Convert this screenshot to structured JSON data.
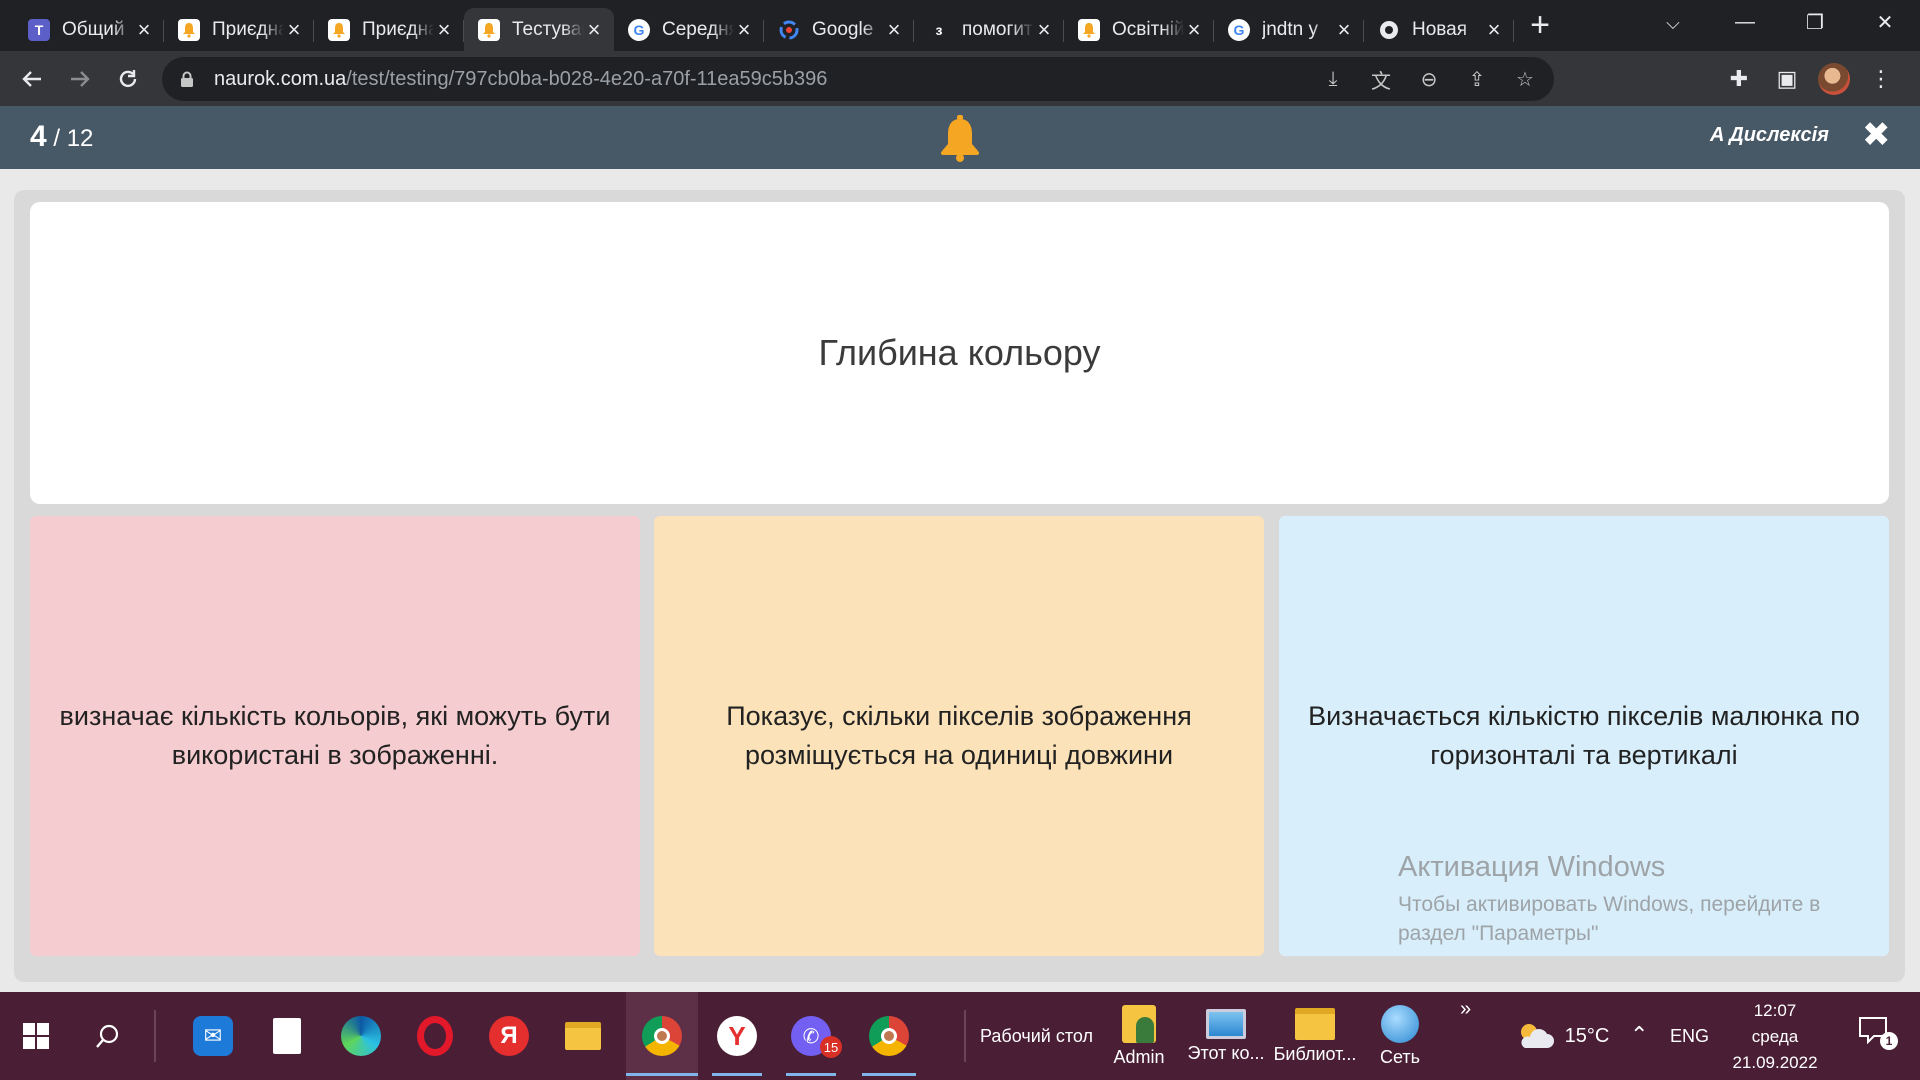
{
  "browser": {
    "tabs": [
      {
        "title": "Общий",
        "favicon": "teams-icon",
        "color": "#5b5fc7",
        "active": false
      },
      {
        "title": "Приєднатись",
        "favicon": "naurok-bell-icon",
        "color": "#f5a623",
        "active": false
      },
      {
        "title": "Приєднатись",
        "favicon": "naurok-bell-icon",
        "color": "#f5a623",
        "active": false
      },
      {
        "title": "Тестування",
        "favicon": "naurok-bell-icon",
        "color": "#f5a623",
        "active": true
      },
      {
        "title": "Середня",
        "favicon": "google-icon",
        "color": "#4285f4",
        "active": false
      },
      {
        "title": "Google",
        "favicon": "google-lens-icon",
        "color": "#ea4335",
        "active": false
      },
      {
        "title": "помогите",
        "favicon": "znanija-icon",
        "color": "#202124",
        "active": false
      },
      {
        "title": "Освітній",
        "favicon": "naurok-bell-icon",
        "color": "#f5a623",
        "active": false
      },
      {
        "title": "jndtn y",
        "favicon": "google-icon",
        "color": "#4285f4",
        "active": false
      },
      {
        "title": "Новая",
        "favicon": "chrome-icon",
        "color": "#9aa0a6",
        "active": false
      }
    ],
    "url_host": "naurok.com.ua",
    "url_path": "/test/testing/797cb0ba-b028-4e20-a70f-11ea59c5b396"
  },
  "quiz": {
    "current": "4",
    "total": "/ 12",
    "dyslexia_label": "Дислексія",
    "question": "Глибина кольору",
    "answers": [
      {
        "text": "визначає кількість кольорів, які можуть бути використані в зображенні.",
        "color": "#f5cccf"
      },
      {
        "text": "Показує, скільки пікселів зображення розміщується на одиниці довжини",
        "color": "#fbe2b8"
      },
      {
        "text": "Визначається кількістю пікселів малюнка по горизонталі та вертикалі",
        "color": "#d8effb"
      }
    ],
    "header_color": "#475866",
    "bell_color": "#f5a623"
  },
  "watermark": {
    "title": "Активация Windows",
    "subtitle": "Чтобы активировать Windows, перейдите в раздел \"Параметры\""
  },
  "taskbar": {
    "desktop_label": "Рабочий стол",
    "folders": [
      {
        "label": "Admin"
      },
      {
        "label": "Этот ко..."
      },
      {
        "label": "Библиот..."
      },
      {
        "label": "Сеть"
      }
    ],
    "viber_badge": "15",
    "temperature": "15°C",
    "language": "ENG",
    "time": "12:07",
    "weekday": "среда",
    "date": "21.09.2022",
    "notifications": "1"
  }
}
